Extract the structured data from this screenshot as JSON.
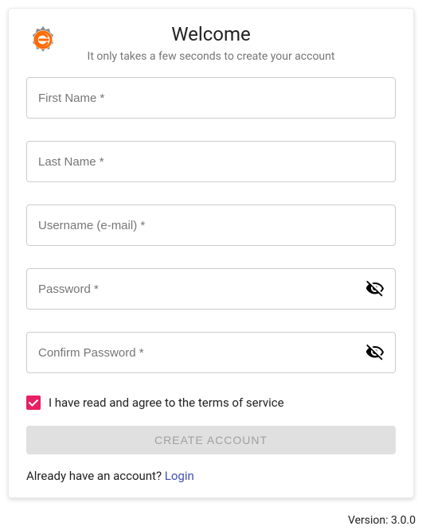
{
  "header": {
    "title": "Welcome",
    "subtitle": "It only takes a few seconds to create your account"
  },
  "fields": {
    "first_name": {
      "placeholder": "First Name *",
      "value": ""
    },
    "last_name": {
      "placeholder": "Last Name *",
      "value": ""
    },
    "username": {
      "placeholder": "Username (e-mail) *",
      "value": ""
    },
    "password": {
      "placeholder": "Password *",
      "value": ""
    },
    "confirm_password": {
      "placeholder": "Confirm Password *",
      "value": ""
    }
  },
  "terms": {
    "checked": true,
    "label": "I have read and agree to the terms of service"
  },
  "submit": {
    "label": "CREATE ACCOUNT"
  },
  "login_prompt": {
    "text": "Already have an account? ",
    "link": "Login"
  },
  "version": {
    "label": "Version: 3.0.0"
  },
  "colors": {
    "accent": "#e91e63",
    "link": "#3f51b5",
    "logo_orange": "#ff6a00"
  }
}
